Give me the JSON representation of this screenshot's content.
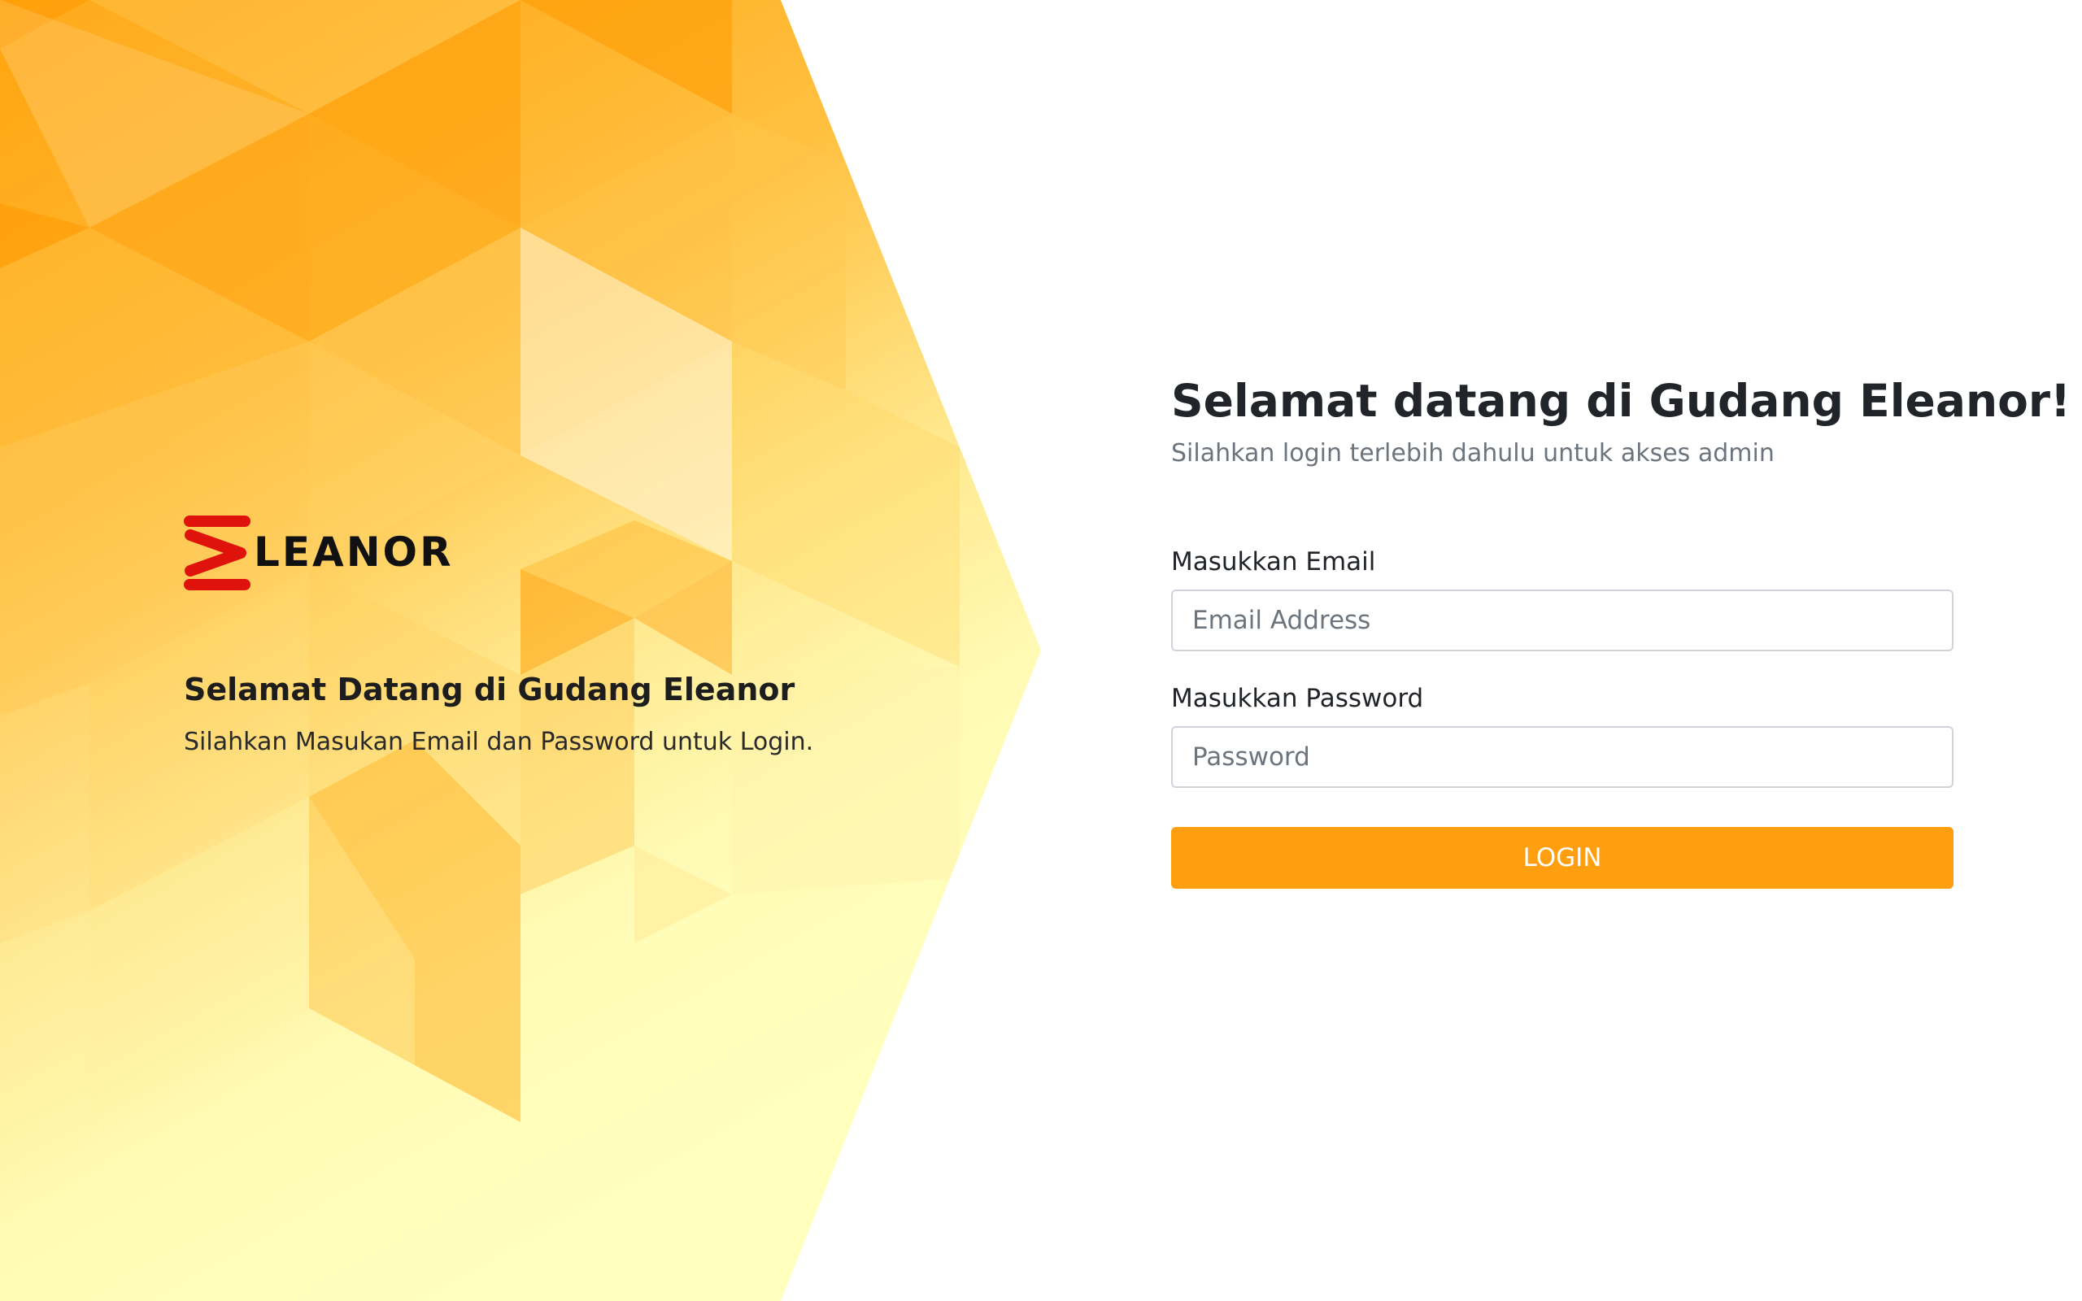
{
  "brand": {
    "logo_text": "LEANOR",
    "logo_mark_color": "#e0120c"
  },
  "hero": {
    "title": "Selamat Datang di Gudang Eleanor",
    "subtitle": "Silahkan Masukan Email dan Password untuk Login."
  },
  "login": {
    "title": "Selamat datang di Gudang Eleanor!",
    "subtitle": "Silahkan login terlebih dahulu untuk akses admin",
    "email_label": "Masukkan Email",
    "email_placeholder": "Email Address",
    "email_value": "",
    "password_label": "Masukkan Password",
    "password_placeholder": "Password",
    "password_value": "",
    "button_label": "LOGIN"
  },
  "colors": {
    "accent": "#ff9f0f",
    "hero_orange": "#ffa012",
    "hero_light": "#fffcbc",
    "title_text": "#212529",
    "muted_text": "#6c757d"
  }
}
